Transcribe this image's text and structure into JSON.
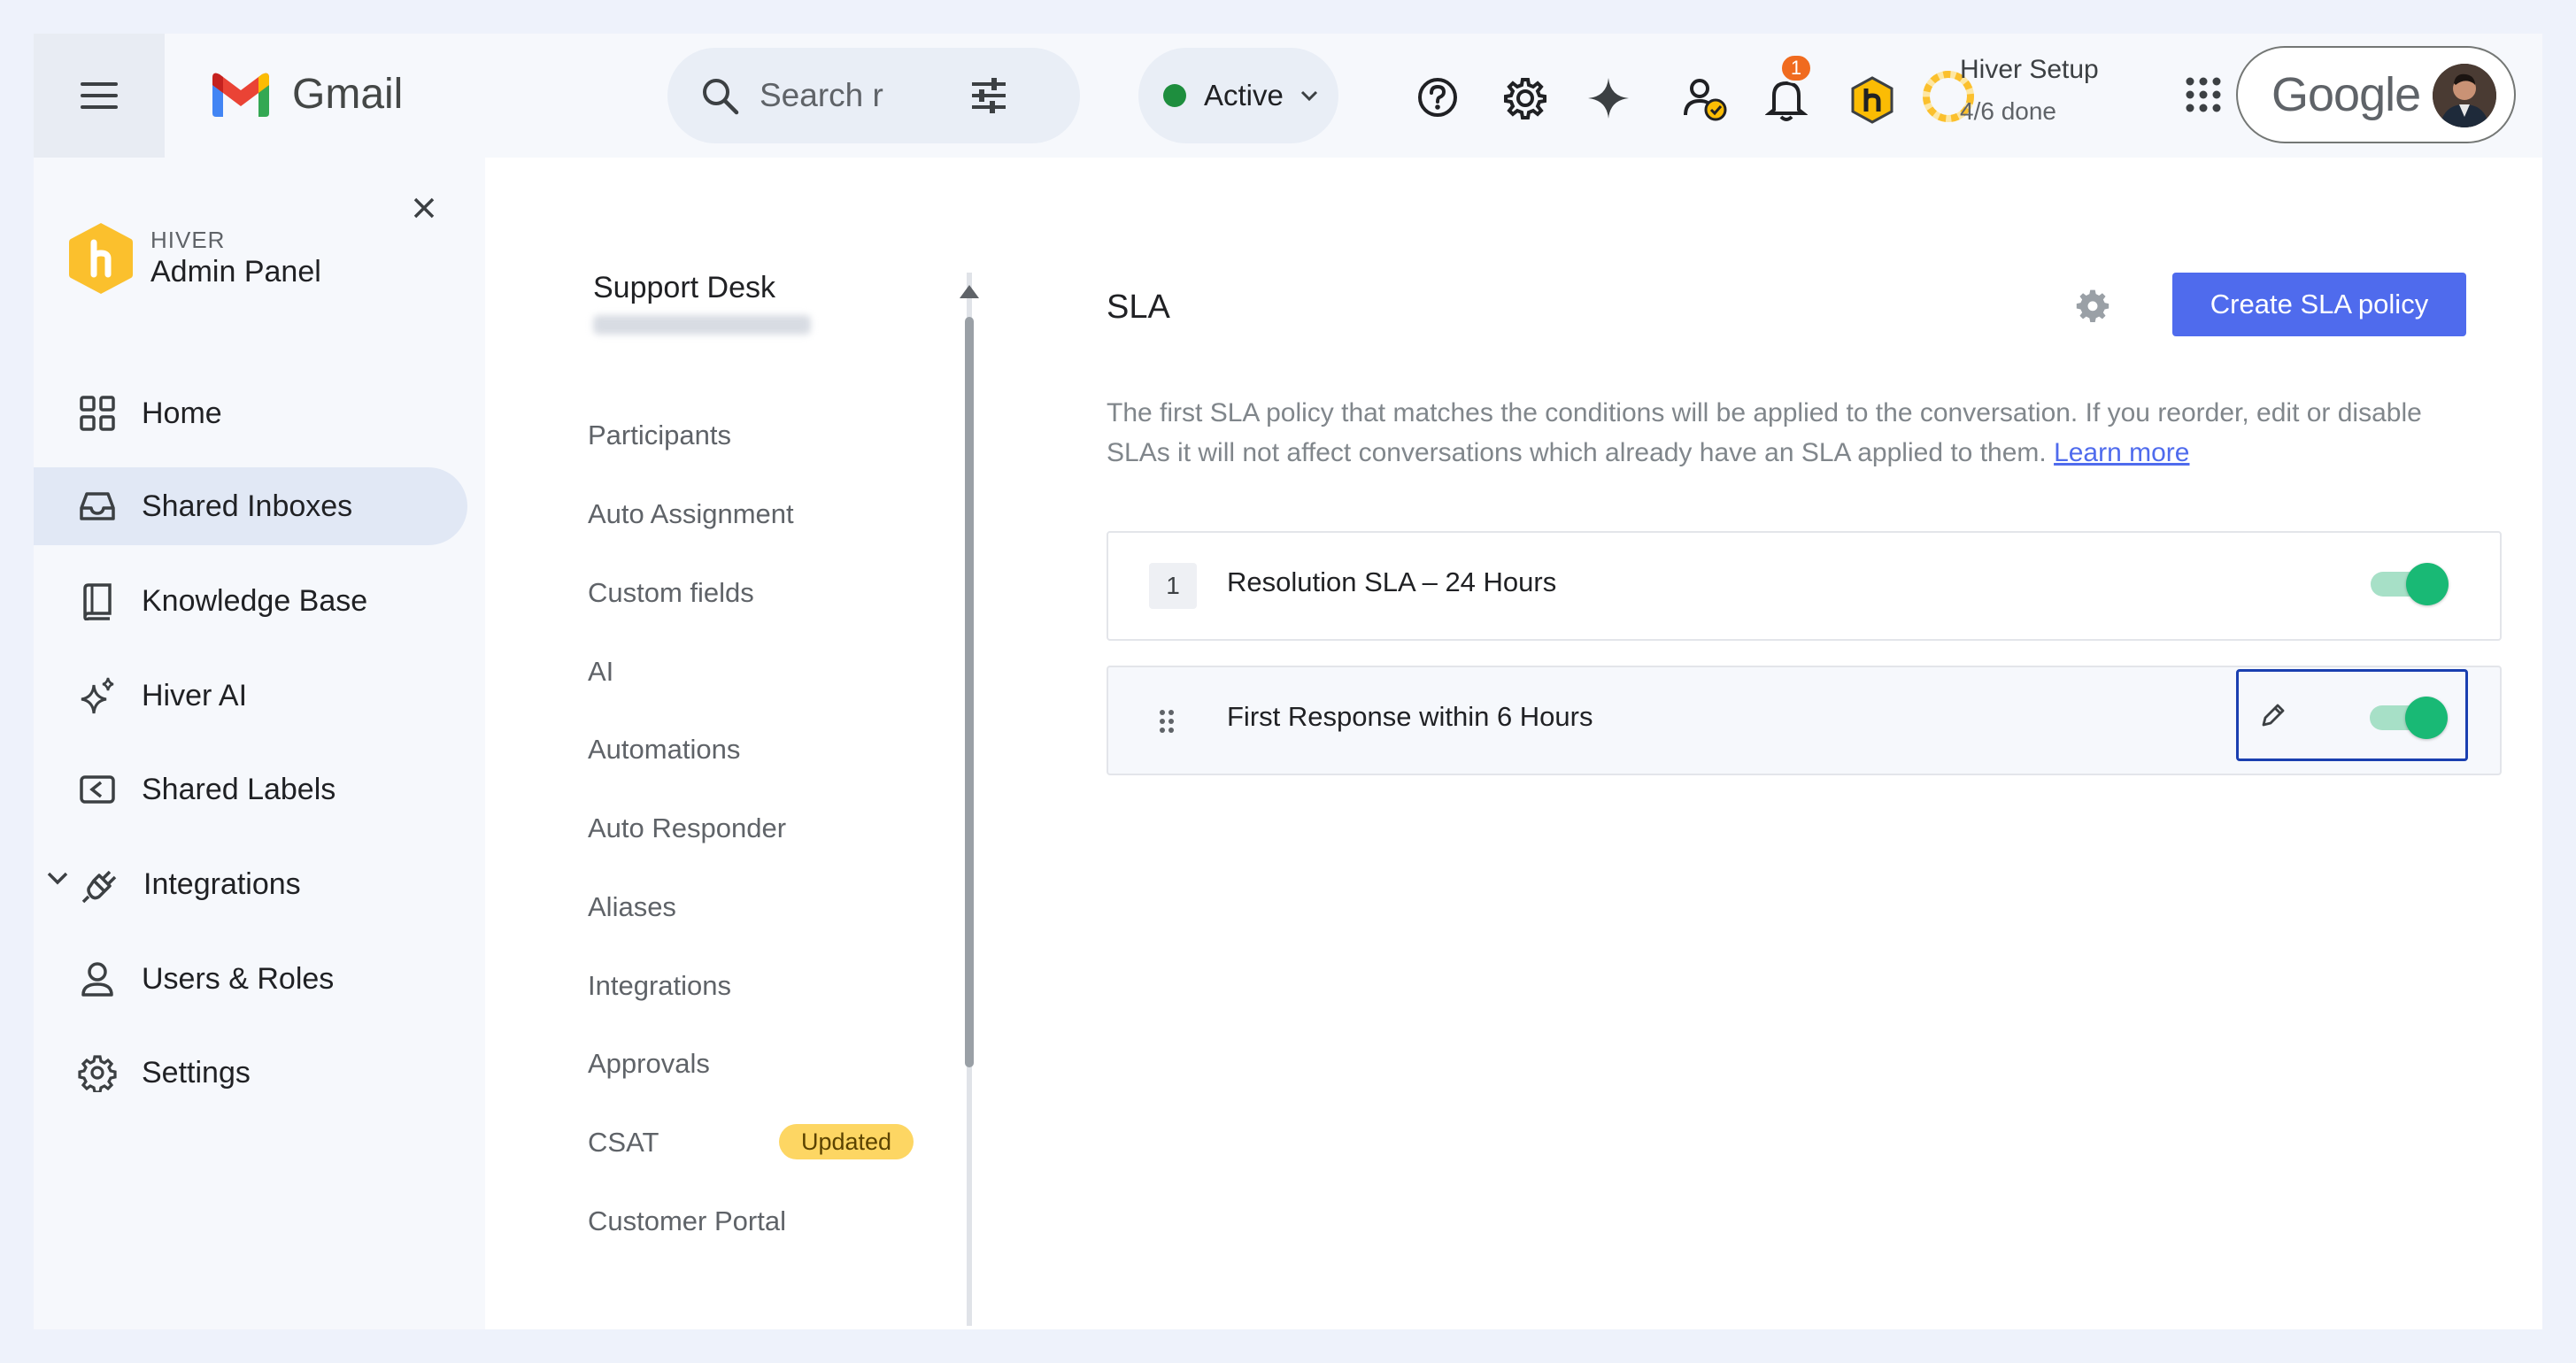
{
  "topbar": {
    "app_name": "Gmail",
    "search_placeholder": "Search r",
    "status_label": "Active",
    "notification_count": "1",
    "setup_title": "Hiver Setup",
    "setup_progress": "4/6 done",
    "setup_progress_fraction": 0.667,
    "account_brand": "Google"
  },
  "sidebar": {
    "brand_small": "HIVER",
    "brand_big": "Admin Panel",
    "items": [
      {
        "label": "Home",
        "icon": "grid-icon"
      },
      {
        "label": "Shared Inboxes",
        "icon": "inbox-icon",
        "selected": true
      },
      {
        "label": "Knowledge Base",
        "icon": "book-icon"
      },
      {
        "label": "Hiver AI",
        "icon": "sparkle-icon"
      },
      {
        "label": "Shared Labels",
        "icon": "label-icon"
      },
      {
        "label": "Integrations",
        "icon": "plug-icon",
        "expandable": true
      },
      {
        "label": "Users & Roles",
        "icon": "user-icon"
      },
      {
        "label": "Settings",
        "icon": "gear-icon"
      }
    ]
  },
  "inbox_menu": {
    "title": "Support Desk",
    "items": [
      {
        "label": "Participants"
      },
      {
        "label": "Auto Assignment"
      },
      {
        "label": "Custom fields"
      },
      {
        "label": "AI"
      },
      {
        "label": "Automations"
      },
      {
        "label": "Auto Responder"
      },
      {
        "label": "Aliases"
      },
      {
        "label": "Integrations"
      },
      {
        "label": "Approvals"
      },
      {
        "label": "CSAT",
        "badge": "Updated"
      },
      {
        "label": "Customer Portal"
      }
    ]
  },
  "sla": {
    "title": "SLA",
    "create_button": "Create SLA policy",
    "description": "The first SLA policy that matches the conditions will be applied to the conversation. If you reorder, edit or disable SLAs it will not affect conversations which already have an SLA applied to them.",
    "learn_more": "Learn more",
    "policies": [
      {
        "order": "1",
        "name": "Resolution SLA – 24 Hours",
        "enabled": true
      },
      {
        "order": "",
        "name": "First Response within 6 Hours",
        "enabled": true
      }
    ]
  },
  "colors": {
    "accent": "#4f6bed",
    "toggle_on": "#19b975",
    "badge_updated": "#fdd663",
    "status_active": "#1e8e3e",
    "notification": "#f06b1f"
  }
}
